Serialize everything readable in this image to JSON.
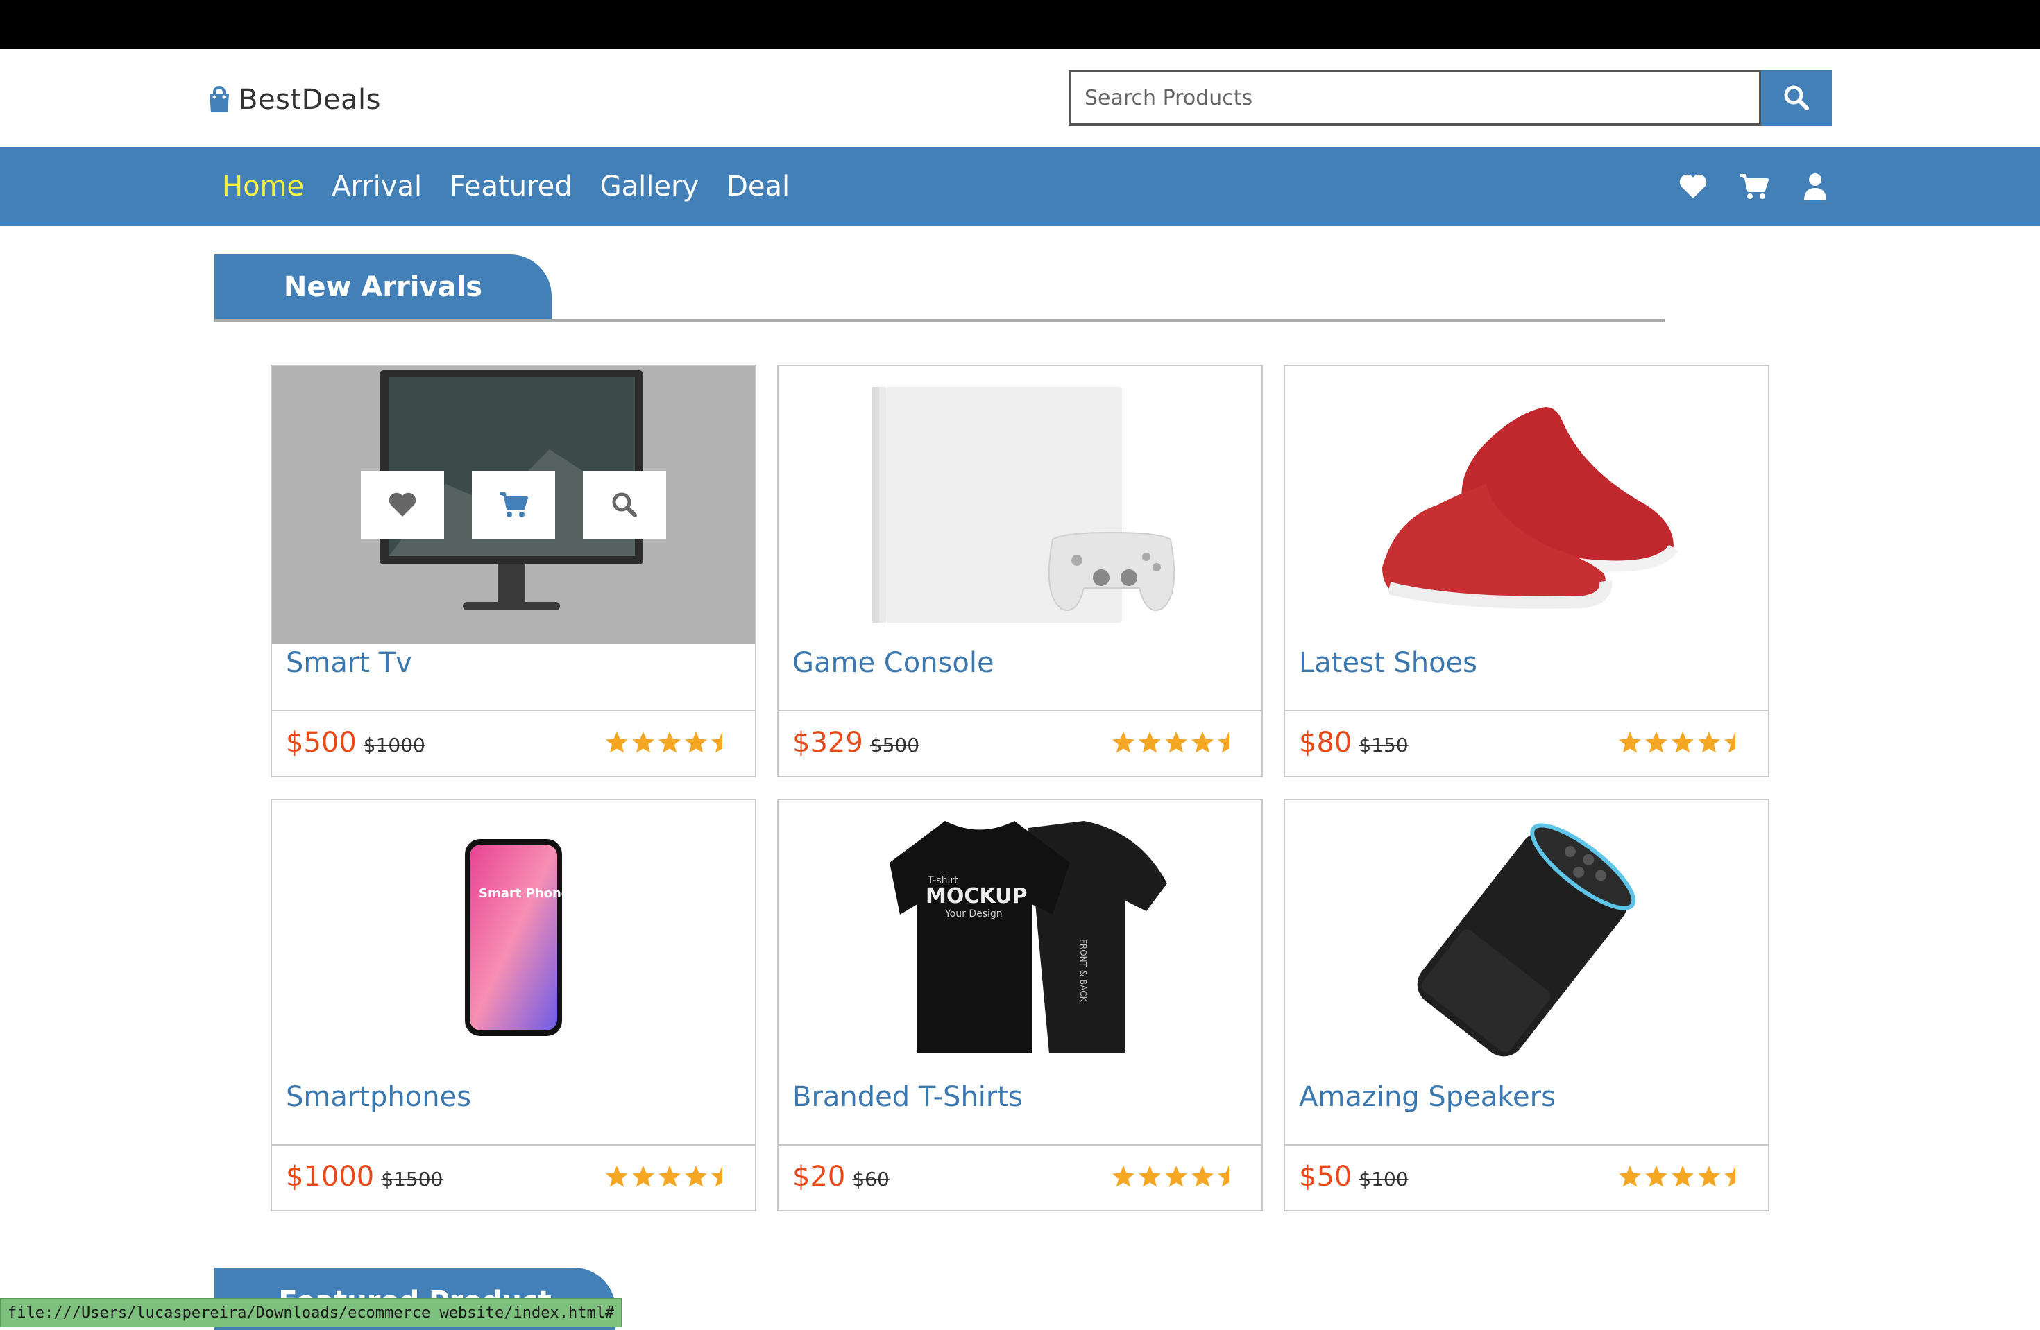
{
  "brand": {
    "name": "BestDeals",
    "icon": "shopping-bag-icon"
  },
  "search": {
    "placeholder": "Search Products",
    "value": ""
  },
  "nav": {
    "links": [
      {
        "label": "Home",
        "active": true
      },
      {
        "label": "Arrival",
        "active": false
      },
      {
        "label": "Featured",
        "active": false
      },
      {
        "label": "Gallery",
        "active": false
      },
      {
        "label": "Deal",
        "active": false
      }
    ],
    "icons": [
      "heart-icon",
      "cart-icon",
      "user-icon"
    ]
  },
  "sections": {
    "new_arrivals": "New Arrivals",
    "featured": "Featured Product"
  },
  "products": [
    {
      "name": "Smart Tv",
      "price": "$500",
      "old_price": "$1000",
      "rating": 4.5,
      "image": "monitor"
    },
    {
      "name": "Game Console",
      "price": "$329",
      "old_price": "$500",
      "rating": 4.5,
      "image": "console"
    },
    {
      "name": "Latest Shoes",
      "price": "$80",
      "old_price": "$150",
      "rating": 4.5,
      "image": "shoes"
    },
    {
      "name": "Smartphones",
      "price": "$1000",
      "old_price": "$1500",
      "rating": 4.5,
      "image": "phone"
    },
    {
      "name": "Branded T-Shirts",
      "price": "$20",
      "old_price": "$60",
      "rating": 4.5,
      "image": "tshirt"
    },
    {
      "name": "Amazing Speakers",
      "price": "$50",
      "old_price": "$100",
      "rating": 4.5,
      "image": "speaker"
    }
  ],
  "product_images": {
    "phone_text": "Smart Phone Mockup Psd",
    "tshirt_text": "MOCKUP",
    "tshirt_sub": "Your Design",
    "tshirt_top": "T-shirt",
    "tshirt_side": "FRONT & BACK"
  },
  "hover_actions": [
    "heart-icon",
    "cart-icon",
    "search-icon"
  ],
  "status_url": "file:///Users/lucaspereira/Downloads/ecommerce website/index.html#",
  "colors": {
    "primary": "#4480b8",
    "active_nav": "#f5f23d",
    "price": "#e64a19",
    "star": "#f5a623",
    "product_name": "#3c78b0"
  }
}
